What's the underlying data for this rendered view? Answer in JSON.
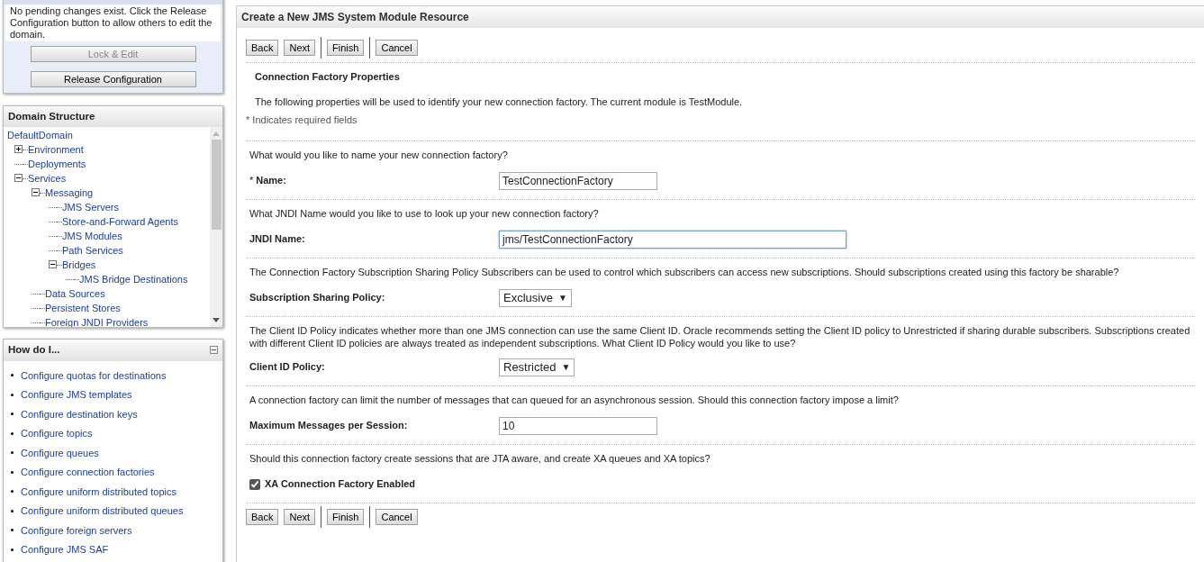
{
  "change_center": {
    "message": "No pending changes exist. Click the Release Configuration button to allow others to edit the domain.",
    "buttons": [
      {
        "label": "Lock & Edit",
        "disabled": true
      },
      {
        "label": "Release Configuration",
        "disabled": false
      }
    ]
  },
  "domain_structure": {
    "title": "Domain Structure",
    "tree": [
      {
        "label": "DefaultDomain",
        "children": [
          {
            "label": "Environment",
            "expanded": false
          },
          {
            "label": "Deployments"
          },
          {
            "label": "Services",
            "expanded": true,
            "children": [
              {
                "label": "Messaging",
                "expanded": true,
                "children": [
                  {
                    "label": "JMS Servers"
                  },
                  {
                    "label": "Store-and-Forward Agents"
                  },
                  {
                    "label": "JMS Modules"
                  },
                  {
                    "label": "Path Services"
                  },
                  {
                    "label": "Bridges",
                    "expanded": true,
                    "children": [
                      {
                        "label": "JMS Bridge Destinations"
                      }
                    ]
                  }
                ]
              },
              {
                "label": "Data Sources"
              },
              {
                "label": "Persistent Stores"
              },
              {
                "label": "Foreign JNDI Providers"
              }
            ]
          }
        ]
      }
    ]
  },
  "how_do_i": {
    "title": "How do I...",
    "links": [
      "Configure quotas for destinations",
      "Configure JMS templates",
      "Configure destination keys",
      "Configure topics",
      "Configure queues",
      "Configure connection factories",
      "Configure uniform distributed topics",
      "Configure uniform distributed queues",
      "Configure foreign servers",
      "Configure JMS SAF"
    ]
  },
  "main": {
    "title": "Create a New JMS System Module Resource",
    "buttons": [
      "Back",
      "Next",
      "Finish",
      "Cancel"
    ],
    "heading": "Connection Factory Properties",
    "intro": "The following properties will be used to identify your new connection factory. The current module is TestModule.",
    "required_note": "* Indicates required fields",
    "sections": [
      {
        "question": "What would you like to name your new connection factory?",
        "kind": "text",
        "required_mark": "*",
        "label": "Name:",
        "value": "TestConnectionFactory",
        "wide": false,
        "focused": false
      },
      {
        "question": "What JNDI Name would you like to use to look up your new connection factory?",
        "kind": "text",
        "label": "JNDI Name:",
        "value": "jms/TestConnectionFactory",
        "wide": true,
        "focused": true
      },
      {
        "question": "The Connection Factory Subscription Sharing Policy Subscribers can be used to control which subscribers can access new subscriptions. Should subscriptions created using this factory be sharable?",
        "kind": "select",
        "label": "Subscription Sharing Policy:",
        "value": "Exclusive",
        "arrow": "▼"
      },
      {
        "question": "The Client ID Policy indicates whether more than one JMS connection can use the same Client ID. Oracle recommends setting the Client ID policy to Unrestricted if sharing durable subscribers. Subscriptions created with different Client ID policies are always treated as independent subscriptions. What Client ID Policy would you like to use?",
        "kind": "select",
        "label": "Client ID Policy:",
        "value": "Restricted",
        "arrow": "▼"
      },
      {
        "question": "A connection factory can limit the number of messages that can queued for an asynchronous session. Should this connection factory impose a limit?",
        "kind": "text",
        "label": "Maximum Messages per Session:",
        "value": "10",
        "wide": false,
        "focused": false
      },
      {
        "question": "Should this connection factory create sessions that are JTA aware, and create XA queues and XA topics?",
        "kind": "checkbox",
        "label": "XA Connection Factory Enabled",
        "checked": true
      }
    ],
    "bottom_buttons": [
      "Back",
      "Next",
      "Finish",
      "Cancel"
    ]
  }
}
